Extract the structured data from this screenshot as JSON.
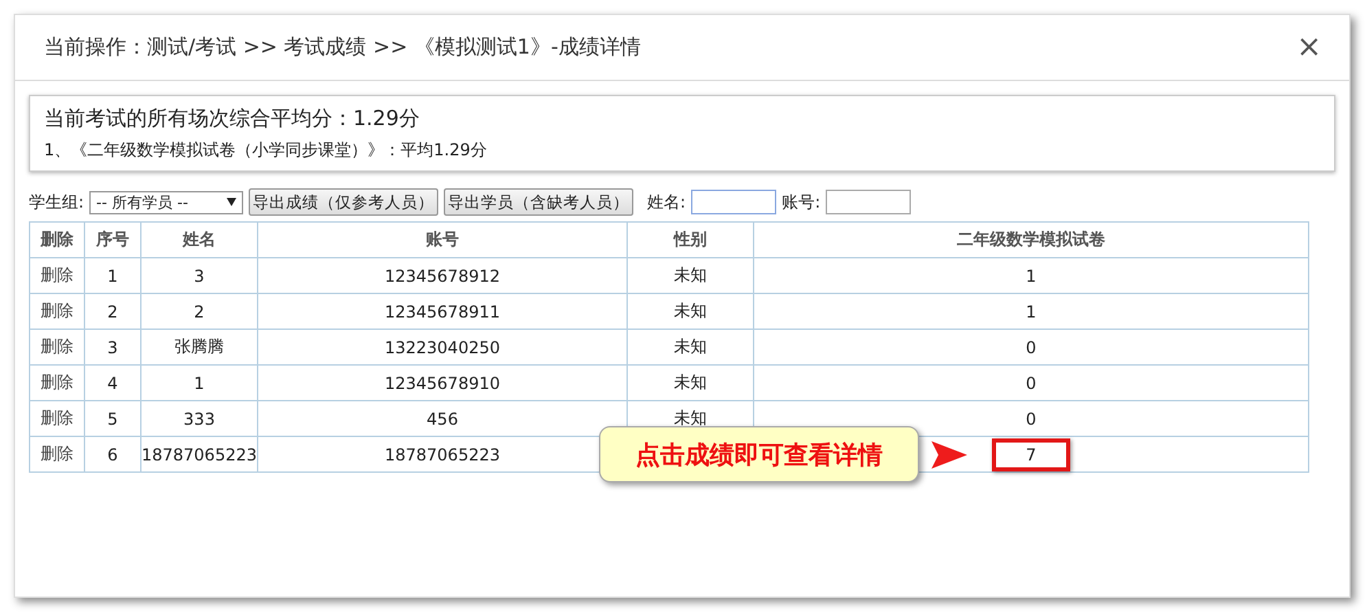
{
  "dialog": {
    "title": "当前操作：测试/考试 >> 考试成绩 >> 《模拟测试1》-成绩详情",
    "close": "×"
  },
  "summary": {
    "overall": "当前考试的所有场次综合平均分：1.29分",
    "items": [
      "1、《二年级数学模拟试卷（小学同步课堂）》：平均1.29分"
    ]
  },
  "toolbar": {
    "group_label": "学生组:",
    "group_value": "-- 所有学员 --",
    "buttons": [
      "导出成绩（仅参考人员）",
      "导出学员（含缺考人员）"
    ],
    "name_label": "姓名:",
    "account_label": "账号:"
  },
  "table": {
    "columns": [
      "删除",
      "序号",
      "姓名",
      "账号",
      "性别",
      "二年级数学模拟试卷"
    ],
    "rows": [
      {
        "delete": "删除",
        "no": "1",
        "name": "3",
        "account": "12345678912",
        "gender": "未知",
        "score": "1",
        "highlighted": false
      },
      {
        "delete": "删除",
        "no": "2",
        "name": "2",
        "account": "12345678911",
        "gender": "未知",
        "score": "1",
        "highlighted": false
      },
      {
        "delete": "删除",
        "no": "3",
        "name": "张腾腾",
        "account": "13223040250",
        "gender": "未知",
        "score": "0",
        "highlighted": false
      },
      {
        "delete": "删除",
        "no": "4",
        "name": "1",
        "account": "12345678910",
        "gender": "未知",
        "score": "0",
        "highlighted": false
      },
      {
        "delete": "删除",
        "no": "5",
        "name": "333",
        "account": "456",
        "gender": "未知",
        "score": "0",
        "highlighted": false
      },
      {
        "delete": "删除",
        "no": "6",
        "name": "18787065223",
        "account": "18787065223",
        "score": "7",
        "highlighted": true
      }
    ]
  },
  "callout": {
    "text": "点击成绩即可查看详情"
  }
}
